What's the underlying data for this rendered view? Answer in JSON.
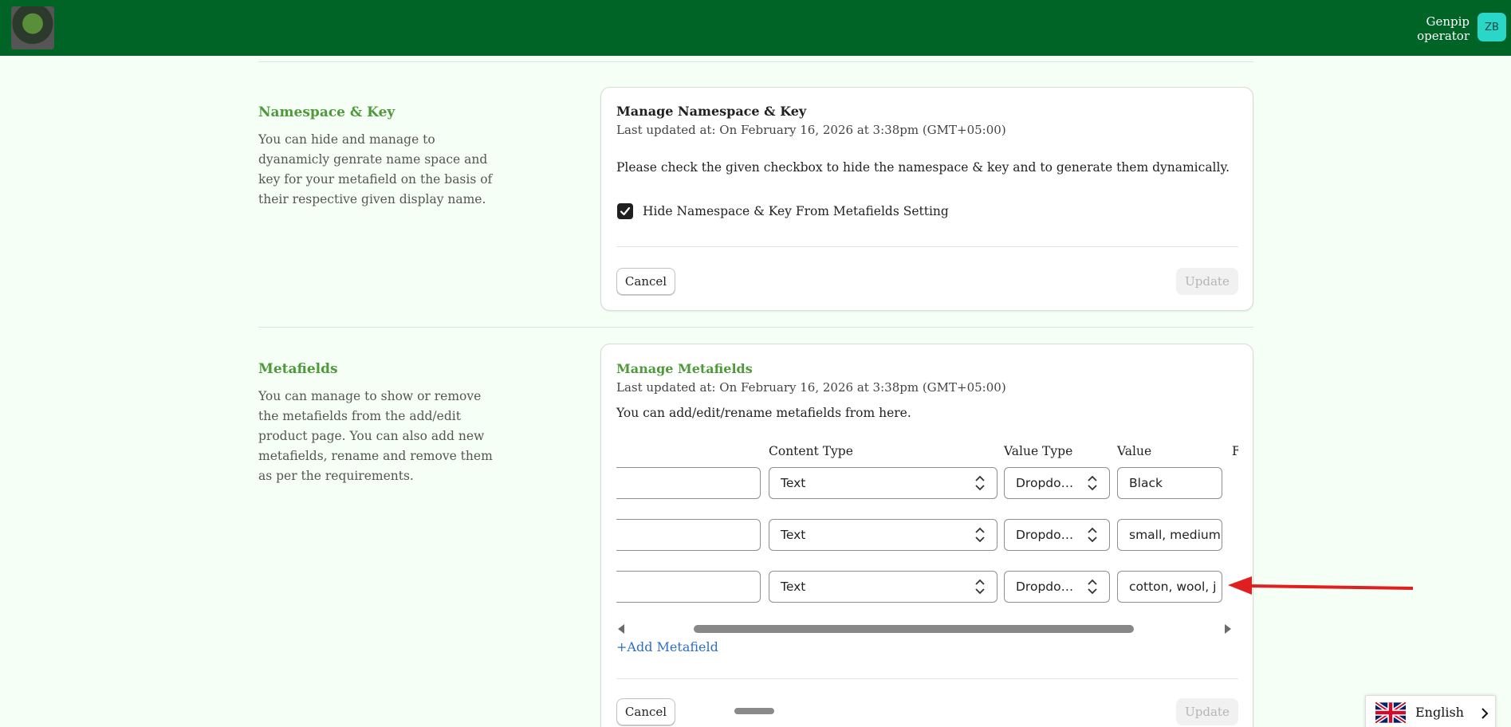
{
  "header": {
    "user_name_line1": "Genpip",
    "user_name_line2": "operator",
    "avatar_initials": "ZB",
    "brand_color": "#006426"
  },
  "namespace_section": {
    "title": "Namespace & Key",
    "description": "You can hide and manage to dyanamicly genrate name space and key for your metafield on the basis of their respective given display name.",
    "card_title": "Manage Namespace & Key",
    "last_updated": "Last updated at: On February 16, 2026 at 3:38pm (GMT+05:00)",
    "instruction": "Please check the given checkbox to hide the namespace & key and to generate them dynamically.",
    "checkbox_label": "Hide Namespace & Key From Metafields Setting",
    "checkbox_checked": true,
    "cancel_label": "Cancel",
    "update_label": "Update"
  },
  "metafields_section": {
    "title": "Metafields",
    "description": "You can manage to show or remove the metafields from the add/edit product page. You can also add new metafields, rename and remove them as per the requirements.",
    "card_title": "Manage Metafields",
    "last_updated": "Last updated at: On February 16, 2026 at 3:38pm (GMT+05:00)",
    "instruction": "You can add/edit/rename metafields from here.",
    "columns": [
      "Content Type",
      "Value Type",
      "Value",
      "F"
    ],
    "rows": [
      {
        "name": "",
        "content_type": "Text",
        "value_type": "Dropdo…",
        "value": "Black"
      },
      {
        "name": "",
        "content_type": "Text",
        "value_type": "Dropdo…",
        "value": "small, medium"
      },
      {
        "name": "",
        "content_type": "Text",
        "value_type": "Dropdo…",
        "value": "cotton, wool, j"
      }
    ],
    "add_label": "+Add Metafield",
    "cancel_label": "Cancel",
    "update_label": "Update"
  },
  "language": {
    "label": "English"
  },
  "annotation_color": "#e02020"
}
